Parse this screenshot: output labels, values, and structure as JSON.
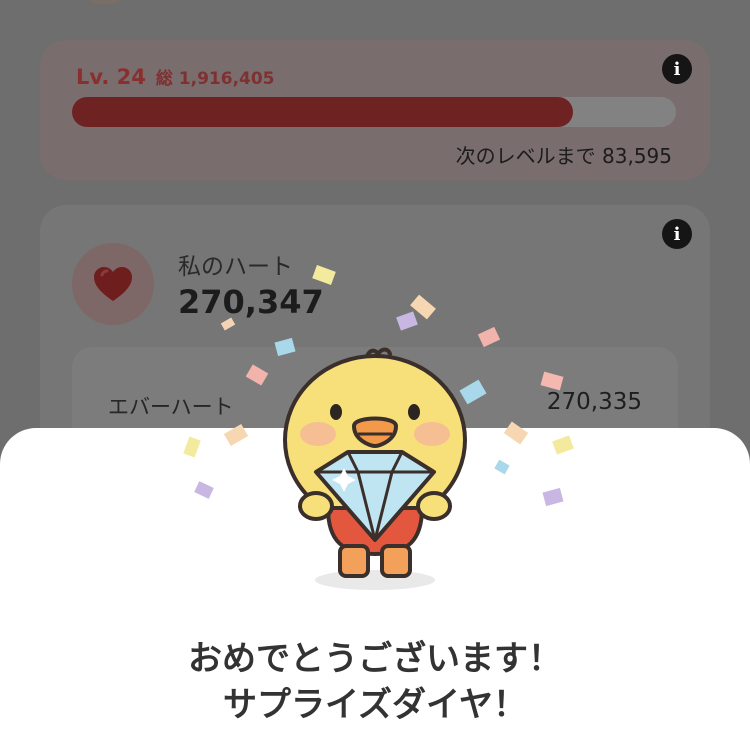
{
  "level_card": {
    "level": "Lv. 24",
    "total": "総 1,916,405",
    "progress": 0.83,
    "next_level_text": "次のレベルまで 83,595"
  },
  "heart_card": {
    "my_heart_label": "私のハート",
    "my_heart_value": "270,347",
    "ever_heart_label": "エバーハート",
    "ever_heart_value": "270,335"
  },
  "modal": {
    "title_line1": "おめでとうございます！",
    "title_line2": "サプライズダイヤ！"
  },
  "icons": {
    "info": "info-icon",
    "heart": "heart-icon",
    "mascot": "chick-holding-diamond"
  },
  "colors": {
    "level_text": "#8a2f2f",
    "progress_fill": "#6e2222",
    "sheet": "#ffffff",
    "diamond": "#bfe4f2",
    "chick": "#f7e07a"
  }
}
